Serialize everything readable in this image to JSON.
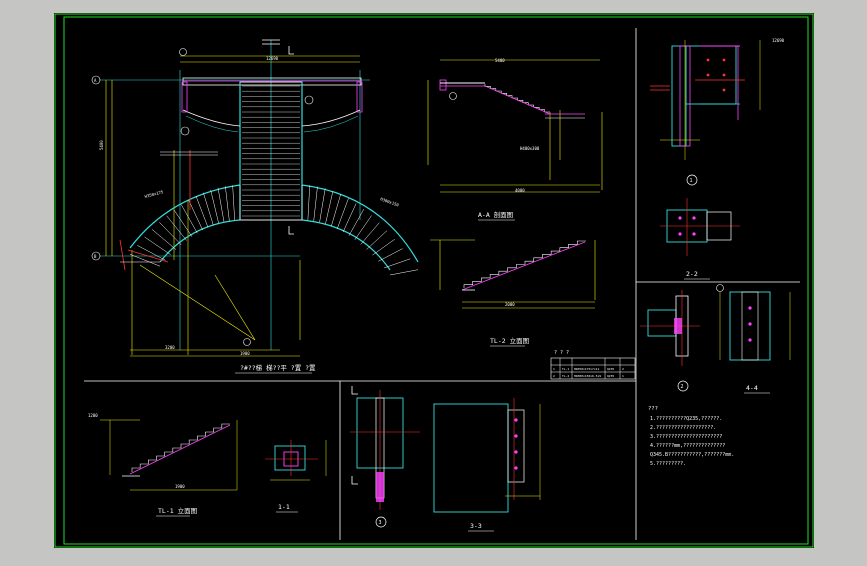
{
  "colors": {
    "background": "#c5c6c3",
    "paper": "#000000",
    "frame": "#22dd22",
    "white": "#ffffff",
    "yellow": "#f0f000",
    "cyan": "#33dddd",
    "red": "#ff3333",
    "magenta": "#ff44ff",
    "green": "#22dd22"
  },
  "labels": {
    "plan_title": "?#??梯 梯??平 ?置 ?置",
    "elev_a_title": "A-A 剖面图",
    "elev_b_title": "TL-2 立面图",
    "elev_c_title": "TL-1 立面图",
    "sec_1": "1-1",
    "sec_2": "2-2",
    "sec_3": "3-3",
    "sec_4": "4-4",
    "node_1": "1",
    "node_2": "2",
    "node_3": "3",
    "node_4": "4",
    "table_title": "? ? ?",
    "dims": {
      "top": "12690",
      "right_top": "12690",
      "a1": "1250",
      "a2": "1100",
      "b1": "3200",
      "b2": "5400",
      "c1": "1900",
      "c2": "2000",
      "d1": "4000",
      "e1": "1200",
      "grid_b": "B",
      "grid_a": "A",
      "mark_h1": "H400x300",
      "mark_h2": "H350x175",
      "mark_h3": "H300x150"
    }
  },
  "table": {
    "rows": [
      [
        "1",
        "TL-1",
        "HN350x175x7x11",
        "Q235",
        "2"
      ],
      [
        "2",
        "TL-2",
        "HN300x150x6.5x9",
        "Q235",
        "1"
      ]
    ]
  },
  "notes": {
    "title": "???",
    "lines": [
      "1.??????????Q235,??????.",
      "2.???????????????????.",
      "3.??????????????????????",
      "4.??????mm,??????????????",
      "  Q345.B???????????,???????mm.",
      "5.?????????."
    ]
  }
}
